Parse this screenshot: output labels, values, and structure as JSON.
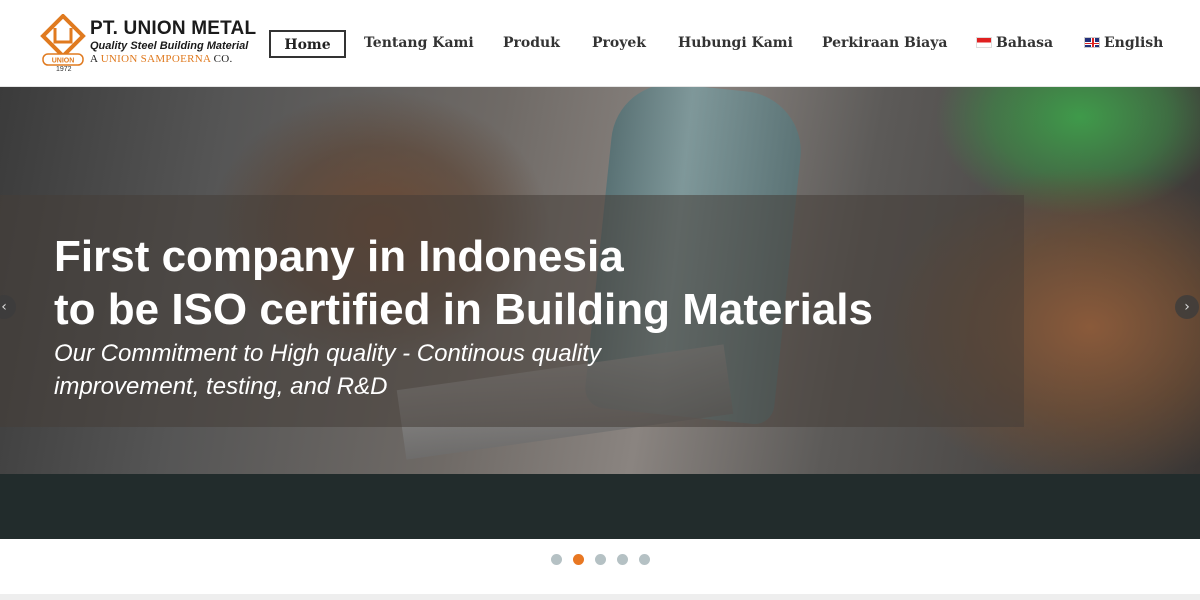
{
  "brand": {
    "title": "PT. UNION METAL",
    "tagline": "Quality Steel Building Material",
    "sub_prefix": "A ",
    "sub_brand": "UNION SAMPOERNA",
    "sub_suffix": " CO.",
    "badge": "UNION",
    "year": "1972",
    "accent_color": "#e07a1f"
  },
  "nav": {
    "home": "Home",
    "about": "Tentang Kami",
    "products": "Produk",
    "projects": "Proyek",
    "contact": "Hubungi Kami",
    "estimate": "Perkiraan Biaya",
    "lang_id": "Bahasa",
    "lang_en": "English",
    "active": "Home"
  },
  "hero": {
    "title_line1": "First company in Indonesia",
    "title_line2": "to be ISO certified in Building Materials",
    "sub_line1": "Our Commitment to High quality - Continous quality",
    "sub_line2": "improvement, testing, and R&D",
    "prev_icon": "chevron-left-icon",
    "next_icon": "chevron-right-icon",
    "prev_glyph": "‹",
    "next_glyph": "›"
  },
  "carousel": {
    "slide_count": 5,
    "active_index": 1,
    "active_color": "#e87722",
    "inactive_color": "#b5c1c4"
  }
}
